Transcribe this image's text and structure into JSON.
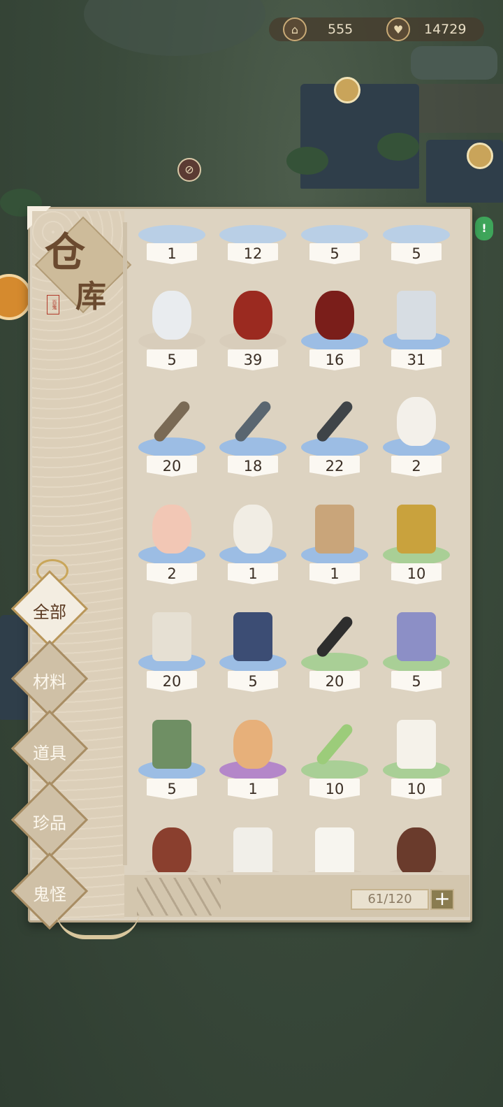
{
  "top_bar": {
    "coins_icon": "gate-coin-icon",
    "coins": "555",
    "favor_icon": "heart-icon",
    "favor": "14729"
  },
  "warehouse": {
    "title_main": "仓",
    "title_sub": "库",
    "seal": "百鬼",
    "tabs": [
      {
        "label": "全部",
        "active": true
      },
      {
        "label": "材料",
        "active": false
      },
      {
        "label": "道具",
        "active": false
      },
      {
        "label": "珍品",
        "active": false
      },
      {
        "label": "鬼怪",
        "active": false
      }
    ],
    "capacity": "61/120",
    "add_label": "+",
    "items": [
      {
        "name": "item-1",
        "count": "1",
        "shadow": "#b9cfe6",
        "icon": "partial-icon"
      },
      {
        "name": "item-2",
        "count": "12",
        "shadow": "#b9cfe6",
        "icon": "partial-icon"
      },
      {
        "name": "item-3",
        "count": "5",
        "shadow": "#b9cfe6",
        "icon": "partial-icon"
      },
      {
        "name": "item-4",
        "count": "5",
        "shadow": "#b9cfe6",
        "icon": "partial-icon"
      },
      {
        "name": "white-jar",
        "count": "5",
        "shadow": "#d8cdbb",
        "icon": "white-jar-icon"
      },
      {
        "name": "wine-jar",
        "count": "39",
        "shadow": "#d8cdbb",
        "icon": "wine-jar-icon"
      },
      {
        "name": "red-wine-jar",
        "count": "16",
        "shadow": "#9cbde4",
        "icon": "red-jar-icon"
      },
      {
        "name": "ice-block",
        "count": "31",
        "shadow": "#9cbde4",
        "icon": "ice-block-icon"
      },
      {
        "name": "hammer",
        "count": "20",
        "shadow": "#9cbde4",
        "icon": "hammer-icon"
      },
      {
        "name": "axe",
        "count": "18",
        "shadow": "#9cbde4",
        "icon": "axe-icon"
      },
      {
        "name": "shovel",
        "count": "22",
        "shadow": "#9cbde4",
        "icon": "shovel-icon"
      },
      {
        "name": "chicken",
        "count": "2",
        "shadow": "#9cbde4",
        "icon": "chicken-icon"
      },
      {
        "name": "pig",
        "count": "2",
        "shadow": "#9cbde4",
        "icon": "pig-icon"
      },
      {
        "name": "sheep",
        "count": "1",
        "shadow": "#9cbde4",
        "icon": "sheep-icon"
      },
      {
        "name": "horse",
        "count": "1",
        "shadow": "#9cbde4",
        "icon": "horse-icon"
      },
      {
        "name": "talisman",
        "count": "10",
        "shadow": "#a9cf96",
        "icon": "talisman-icon"
      },
      {
        "name": "brush-vase",
        "count": "20",
        "shadow": "#9cbde4",
        "icon": "brush-vase-icon"
      },
      {
        "name": "book",
        "count": "5",
        "shadow": "#9cbde4",
        "icon": "book-icon"
      },
      {
        "name": "pickaxe",
        "count": "20",
        "shadow": "#a9cf96",
        "icon": "pickaxe-icon"
      },
      {
        "name": "gift-bundle",
        "count": "5",
        "shadow": "#a9cf96",
        "icon": "gift-bundle-icon"
      },
      {
        "name": "green-pouch",
        "count": "5",
        "shadow": "#9cbde4",
        "icon": "pouch-icon"
      },
      {
        "name": "treasure-sack",
        "count": "1",
        "shadow": "#b487c9",
        "icon": "sack-icon"
      },
      {
        "name": "scallion",
        "count": "10",
        "shadow": "#a9cf96",
        "icon": "scallion-icon"
      },
      {
        "name": "tofu",
        "count": "10",
        "shadow": "#a9cf96",
        "icon": "tofu-icon"
      },
      {
        "name": "teapot",
        "count": "",
        "shadow": "#d8cdbb",
        "icon": "teapot-icon"
      },
      {
        "name": "salt",
        "count": "",
        "shadow": "#d8cdbb",
        "icon": "salt-icon"
      },
      {
        "name": "sugar",
        "count": "",
        "shadow": "#d8cdbb",
        "icon": "sugar-icon"
      },
      {
        "name": "sauce-jar",
        "count": "",
        "shadow": "#d8cdbb",
        "icon": "sauce-jar-icon"
      }
    ]
  }
}
